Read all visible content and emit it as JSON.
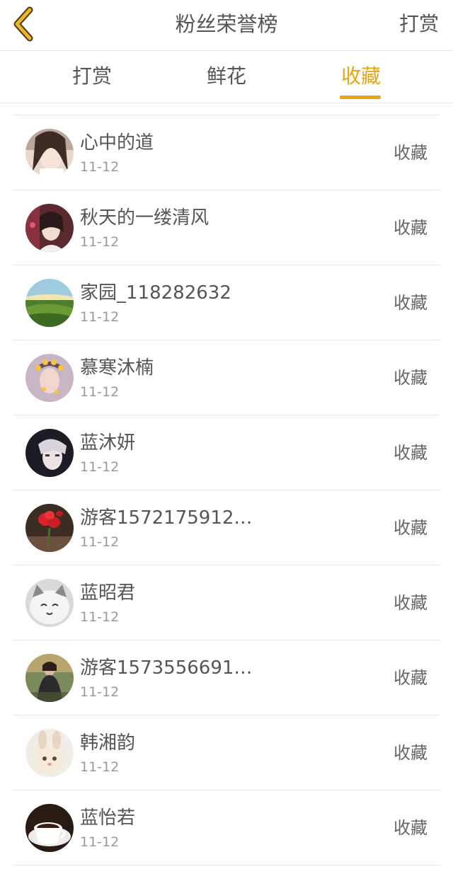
{
  "nav": {
    "title": "粉丝荣誉榜",
    "action_label": "打赏",
    "back_icon": "chevron-left-icon",
    "accent_color": "#e8a317"
  },
  "tabs": [
    {
      "label": "打赏",
      "active": false
    },
    {
      "label": "鲜花",
      "active": false
    },
    {
      "label": "收藏",
      "active": true
    }
  ],
  "list": [
    {
      "name": "心中的道",
      "date": "11-12",
      "action": "收藏",
      "avatar": "avatar-girl-portrait"
    },
    {
      "name": "秋天的一缕清风",
      "date": "11-12",
      "action": "收藏",
      "avatar": "avatar-costume-portrait"
    },
    {
      "name": "家园_118282632",
      "date": "11-12",
      "action": "收藏",
      "avatar": "avatar-landscape"
    },
    {
      "name": "慕寒沐楠",
      "date": "11-12",
      "action": "收藏",
      "avatar": "avatar-flower-crown"
    },
    {
      "name": "蓝沐妍",
      "date": "11-12",
      "action": "收藏",
      "avatar": "avatar-boy-portrait"
    },
    {
      "name": "游客1572175912…",
      "date": "11-12",
      "action": "收藏",
      "avatar": "avatar-red-flower"
    },
    {
      "name": "蓝昭君",
      "date": "11-12",
      "action": "收藏",
      "avatar": "avatar-cat"
    },
    {
      "name": "游客1573556691…",
      "date": "11-12",
      "action": "收藏",
      "avatar": "avatar-person-outdoor"
    },
    {
      "name": "韩湘韵",
      "date": "11-12",
      "action": "收藏",
      "avatar": "avatar-bunny"
    },
    {
      "name": "蓝怡若",
      "date": "11-12",
      "action": "收藏",
      "avatar": "avatar-coffee"
    }
  ]
}
